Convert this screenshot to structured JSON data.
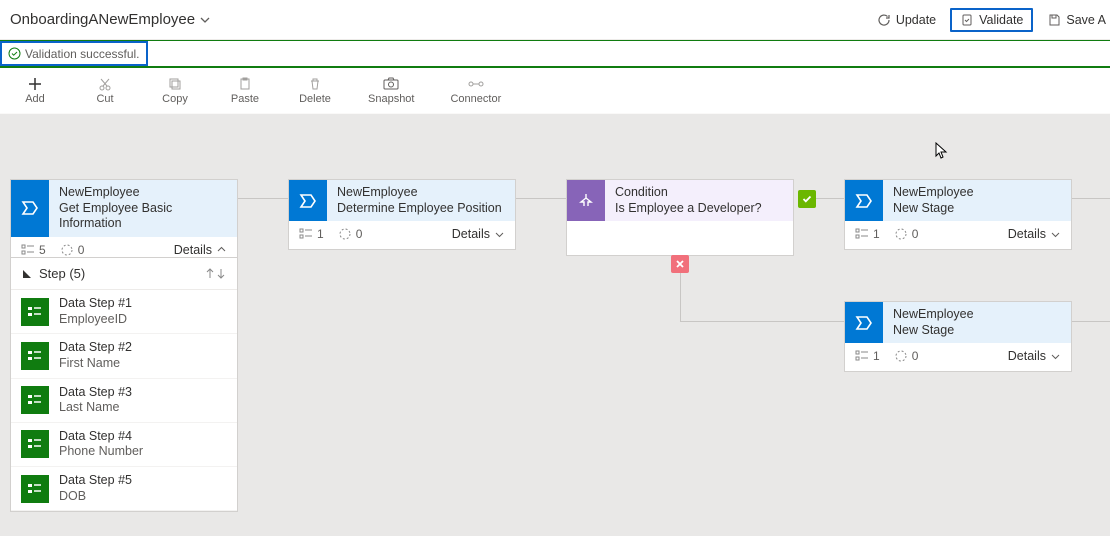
{
  "header": {
    "title": "OnboardingANewEmployee",
    "update": "Update",
    "validate": "Validate",
    "save": "Save A"
  },
  "validation": "Validation successful.",
  "toolbar": {
    "add": "Add",
    "cut": "Cut",
    "copy": "Copy",
    "paste": "Paste",
    "delete": "Delete",
    "snapshot": "Snapshot",
    "connector": "Connector"
  },
  "stages": {
    "s1": {
      "title": "NewEmployee",
      "sub": "Get Employee Basic Information",
      "steps": "5",
      "triggers": "0",
      "details": "Details"
    },
    "s2": {
      "title": "NewEmployee",
      "sub": "Determine Employee Position",
      "steps": "1",
      "triggers": "0",
      "details": "Details"
    },
    "cond": {
      "title": "Condition",
      "sub": "Is Employee a Developer?"
    },
    "s3": {
      "title": "NewEmployee",
      "sub": "New Stage",
      "steps": "1",
      "triggers": "0",
      "details": "Details"
    },
    "s4": {
      "title": "NewEmployee",
      "sub": "New Stage",
      "steps": "1",
      "triggers": "0",
      "details": "Details"
    }
  },
  "stepSection": {
    "title": "Step (5)",
    "items": [
      {
        "t": "Data Step #1",
        "s": "EmployeeID"
      },
      {
        "t": "Data Step #2",
        "s": "First Name"
      },
      {
        "t": "Data Step #3",
        "s": "Last Name"
      },
      {
        "t": "Data Step #4",
        "s": "Phone Number"
      },
      {
        "t": "Data Step #5",
        "s": "DOB"
      }
    ]
  }
}
